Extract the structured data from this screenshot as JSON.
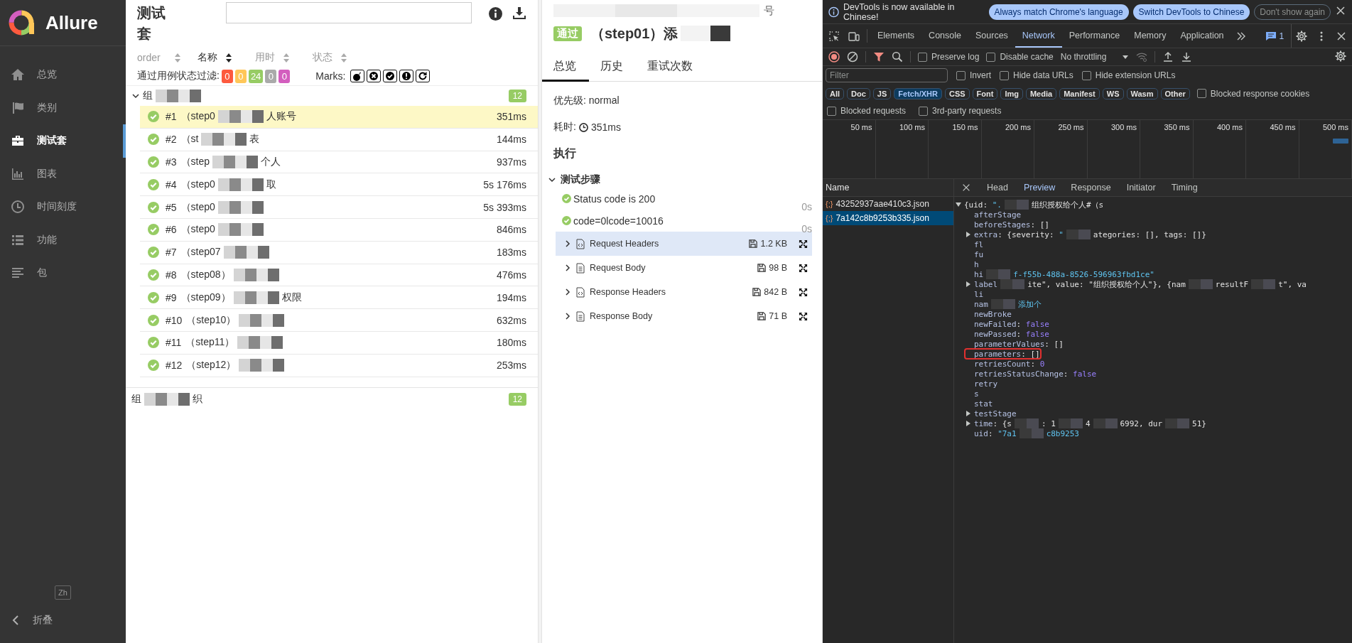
{
  "sidebar": {
    "logo": "Allure",
    "items": [
      {
        "label": "总览",
        "selected": false
      },
      {
        "label": "类别",
        "selected": false
      },
      {
        "label": "测试套",
        "selected": true
      },
      {
        "label": "图表",
        "selected": false
      },
      {
        "label": "时间刻度",
        "selected": false
      },
      {
        "label": "功能",
        "selected": false
      },
      {
        "label": "包",
        "selected": false
      }
    ],
    "language_button": "Zh",
    "collapse": "折叠"
  },
  "suites": {
    "title": "测试套",
    "sort_columns": [
      {
        "label": "order",
        "selected": false
      },
      {
        "label": "名称",
        "selected": true
      },
      {
        "label": "用时",
        "selected": false
      },
      {
        "label": "状态",
        "selected": false
      }
    ],
    "status_filter": {
      "label": "通过用例状态过滤:",
      "counts": [
        {
          "value": "0",
          "color": "#fd5a3e"
        },
        {
          "value": "0",
          "color": "#ffc759"
        },
        {
          "value": "24",
          "color": "#97cc64"
        },
        {
          "value": "0",
          "color": "#aaaaaa"
        },
        {
          "value": "0",
          "color": "#d35ebe"
        }
      ]
    },
    "marks_label": "Marks:",
    "groups": [
      {
        "name": "组",
        "count": "12",
        "expanded": true,
        "tests": [
          {
            "number": "#1",
            "name": "（step0",
            "name_tail": "人账号",
            "duration": "351ms",
            "selected": true
          },
          {
            "number": "#2",
            "name": "（st",
            "name_tail": "表",
            "duration": "144ms",
            "selected": false
          },
          {
            "number": "#3",
            "name": "（step",
            "name_tail": "个人",
            "duration": "937ms",
            "selected": false
          },
          {
            "number": "#4",
            "name": "（step0",
            "name_tail": "取",
            "duration": "5s 176ms",
            "selected": false
          },
          {
            "number": "#5",
            "name": "（step0",
            "duration": "5s 393ms",
            "selected": false
          },
          {
            "number": "#6",
            "name": "（step0",
            "duration": "846ms",
            "selected": false
          },
          {
            "number": "#7",
            "name": "（step07",
            "duration": "183ms",
            "selected": false
          },
          {
            "number": "#8",
            "name": "（step08）",
            "duration": "476ms",
            "selected": false
          },
          {
            "number": "#9",
            "name": "（step09）",
            "name_tail": "权限",
            "duration": "194ms",
            "selected": false
          },
          {
            "number": "#10",
            "name": "（step10）",
            "duration": "632ms",
            "selected": false
          },
          {
            "number": "#11",
            "name": "（step11）",
            "duration": "180ms",
            "selected": false
          },
          {
            "number": "#12",
            "name": "（step12）",
            "duration": "253ms",
            "selected": false
          }
        ]
      },
      {
        "name": "组",
        "name_tail": "织",
        "count": "12",
        "expanded": false
      }
    ]
  },
  "test": {
    "header_tail": "号",
    "status_badge": "通过",
    "title": "（step01）添",
    "tabs": [
      {
        "label": "总览",
        "selected": true
      },
      {
        "label": "历史",
        "selected": false
      },
      {
        "label": "重试次数",
        "selected": false
      }
    ],
    "priority": "优先级: normal",
    "duration_label": "耗时:",
    "duration": "351ms",
    "execution": "执行",
    "steps_section": {
      "title": "测试步骤",
      "expanded": true,
      "steps": [
        {
          "name": "Status code is 200",
          "duration": "0s"
        },
        {
          "name": "code=0lcode=10016",
          "duration": "0s"
        }
      ],
      "attachments": [
        {
          "kind": "code",
          "name": "Request Headers",
          "size": "1.2 KB",
          "selected": true
        },
        {
          "kind": "text",
          "name": "Request Body",
          "size": "98 B",
          "selected": false
        },
        {
          "kind": "code",
          "name": "Response Headers",
          "size": "842 B",
          "selected": false
        },
        {
          "kind": "text",
          "name": "Response Body",
          "size": "71 B",
          "selected": false
        }
      ]
    }
  },
  "devtools": {
    "banner": {
      "text": "DevTools is now available in Chinese!",
      "buttons": [
        {
          "label": "Always match Chrome's language",
          "kind": "primary"
        },
        {
          "label": "Switch DevTools to Chinese",
          "kind": "primary"
        },
        {
          "label": "Don't show again",
          "kind": "outline"
        }
      ]
    },
    "tabs": [
      {
        "label": "Elements",
        "selected": false
      },
      {
        "label": "Console",
        "selected": false
      },
      {
        "label": "Sources",
        "selected": false
      },
      {
        "label": "Network",
        "selected": true
      },
      {
        "label": "Performance",
        "selected": false
      },
      {
        "label": "Memory",
        "selected": false
      },
      {
        "label": "Application",
        "selected": false
      }
    ],
    "issues_count": "1",
    "toolbar": {
      "options": [
        {
          "label": "Preserve log",
          "checked": false
        },
        {
          "label": "Disable cache",
          "checked": false
        }
      ],
      "throttling": "No throttling"
    },
    "filter": {
      "placeholder": "Filter",
      "options": [
        {
          "label": "Invert",
          "checked": false
        },
        {
          "label": "Hide data URLs",
          "checked": false
        },
        {
          "label": "Hide extension URLs",
          "checked": false
        }
      ]
    },
    "type_filters": [
      {
        "label": "All",
        "selected": false
      },
      {
        "label": "Doc",
        "selected": false
      },
      {
        "label": "JS",
        "selected": false
      },
      {
        "label": "Fetch/XHR",
        "selected": true
      },
      {
        "label": "CSS",
        "selected": false
      },
      {
        "label": "Font",
        "selected": false
      },
      {
        "label": "Img",
        "selected": false
      },
      {
        "label": "Media",
        "selected": false
      },
      {
        "label": "Manifest",
        "selected": false
      },
      {
        "label": "WS",
        "selected": false
      },
      {
        "label": "Wasm",
        "selected": false
      },
      {
        "label": "Other",
        "selected": false
      }
    ],
    "blocked_response_cookies": {
      "label": "Blocked response cookies",
      "checked": false
    },
    "request_options": [
      {
        "label": "Blocked requests",
        "checked": false
      },
      {
        "label": "3rd-party requests",
        "checked": false
      }
    ],
    "timeline_ticks": [
      "50 ms",
      "100 ms",
      "150 ms",
      "200 ms",
      "250 ms",
      "300 ms",
      "350 ms",
      "400 ms",
      "450 ms",
      "500 ms"
    ],
    "requests": {
      "column": "Name",
      "rows": [
        {
          "icon": "{;}",
          "name": "43252937aae410c3.json",
          "selected": false
        },
        {
          "icon": "{;}",
          "name": "7a142c8b9253b335.json",
          "selected": true
        }
      ]
    },
    "detail_tabs": [
      {
        "label": "Head",
        "selected": false
      },
      {
        "label": "Preview",
        "selected": true
      },
      {
        "label": "Response",
        "selected": false
      },
      {
        "label": "Initiator",
        "selected": false
      },
      {
        "label": "Timing",
        "selected": false
      }
    ],
    "preview": {
      "expanded": true,
      "boxed": false,
      "parts": [
        {
          "text": "{uid: ",
          "kind": "plain"
        },
        {
          "text": "\".",
          "kind": "string"
        },
        {
          "text": "组织授权给个人#（s",
          "kind": "plain",
          "redacted_before": true
        }
      ],
      "children": [
        {
          "boxed": false,
          "parts": [
            {
              "text": "afterStage",
              "kind": "key"
            }
          ]
        },
        {
          "boxed": false,
          "parts": [
            {
              "text": "beforeStages",
              "kind": "key"
            },
            {
              "text": ": []",
              "kind": "plain"
            }
          ]
        },
        {
          "expanded": false,
          "boxed": false,
          "parts": [
            {
              "text": "extra",
              "kind": "key"
            },
            {
              "text": ": {severity: ",
              "kind": "plain"
            },
            {
              "text": "\"",
              "kind": "string"
            },
            {
              "text": "ategories: [], tags: []}",
              "kind": "plain",
              "redacted_before": true
            }
          ]
        },
        {
          "boxed": false,
          "parts": [
            {
              "text": "fl",
              "kind": "key"
            }
          ]
        },
        {
          "boxed": false,
          "parts": [
            {
              "text": "fu",
              "kind": "key"
            }
          ]
        },
        {
          "boxed": false,
          "parts": [
            {
              "text": "h",
              "kind": "key"
            }
          ]
        },
        {
          "boxed": false,
          "parts": [
            {
              "text": "hi",
              "kind": "key"
            },
            {
              "text": "f-f55b-488a-8526-596963fbd1ce\"",
              "kind": "string",
              "redacted_before": true
            }
          ]
        },
        {
          "expanded": false,
          "boxed": false,
          "parts": [
            {
              "text": "label",
              "kind": "key"
            },
            {
              "text": "ite\", value: \"组织授权给个人\"}, {nam",
              "kind": "plain",
              "redacted_before": true
            },
            {
              "text": "resultF",
              "kind": "plain",
              "redacted_before": true
            },
            {
              "text": "t\", va",
              "kind": "plain",
              "redacted_before": true
            }
          ]
        },
        {
          "boxed": false,
          "parts": [
            {
              "text": "li",
              "kind": "key"
            }
          ]
        },
        {
          "boxed": false,
          "parts": [
            {
              "text": "nam",
              "kind": "key"
            },
            {
              "text": "添加个",
              "kind": "string",
              "redacted_before": true
            }
          ]
        },
        {
          "boxed": false,
          "parts": [
            {
              "text": "newBroke",
              "kind": "key"
            }
          ]
        },
        {
          "boxed": false,
          "parts": [
            {
              "text": "newFailed",
              "kind": "key"
            },
            {
              "text": ": ",
              "kind": "plain"
            },
            {
              "text": "false",
              "kind": "literal"
            }
          ]
        },
        {
          "boxed": false,
          "parts": [
            {
              "text": "newPassed",
              "kind": "key"
            },
            {
              "text": ": ",
              "kind": "plain"
            },
            {
              "text": "false",
              "kind": "literal"
            }
          ]
        },
        {
          "boxed": false,
          "parts": [
            {
              "text": "parameterValues",
              "kind": "key"
            },
            {
              "text": ": []",
              "kind": "plain"
            }
          ]
        },
        {
          "boxed": true,
          "parts": [
            {
              "text": "parameters",
              "kind": "key"
            },
            {
              "text": ": []",
              "kind": "plain"
            }
          ]
        },
        {
          "boxed": false,
          "parts": [
            {
              "text": "retriesCount",
              "kind": "key"
            },
            {
              "text": ": ",
              "kind": "plain"
            },
            {
              "text": "0",
              "kind": "literal"
            }
          ]
        },
        {
          "boxed": false,
          "parts": [
            {
              "text": "retriesStatusChange",
              "kind": "key"
            },
            {
              "text": ": ",
              "kind": "plain"
            },
            {
              "text": "false",
              "kind": "literal"
            }
          ]
        },
        {
          "boxed": false,
          "parts": [
            {
              "text": "retry",
              "kind": "key"
            }
          ]
        },
        {
          "boxed": false,
          "parts": [
            {
              "text": "s",
              "kind": "key"
            }
          ]
        },
        {
          "boxed": false,
          "parts": [
            {
              "text": "stat",
              "kind": "key"
            }
          ]
        },
        {
          "expanded": false,
          "boxed": false,
          "parts": [
            {
              "text": "testStage",
              "kind": "key"
            }
          ]
        },
        {
          "expanded": false,
          "boxed": false,
          "parts": [
            {
              "text": "time",
              "kind": "key"
            },
            {
              "text": ": {s",
              "kind": "plain"
            },
            {
              "text": ": 1",
              "kind": "plain",
              "redacted_before": true
            },
            {
              "text": "4",
              "kind": "plain",
              "redacted_before": true
            },
            {
              "text": "6992, dur",
              "kind": "plain",
              "redacted_before": true
            },
            {
              "text": "51}",
              "kind": "plain",
              "redacted_before": true
            }
          ]
        },
        {
          "boxed": false,
          "parts": [
            {
              "text": "uid",
              "kind": "key"
            },
            {
              "text": ": ",
              "kind": "plain"
            },
            {
              "text": "\"7a1",
              "kind": "string"
            },
            {
              "text": "c8b9253",
              "kind": "string",
              "redacted_before": true
            }
          ]
        }
      ]
    }
  }
}
